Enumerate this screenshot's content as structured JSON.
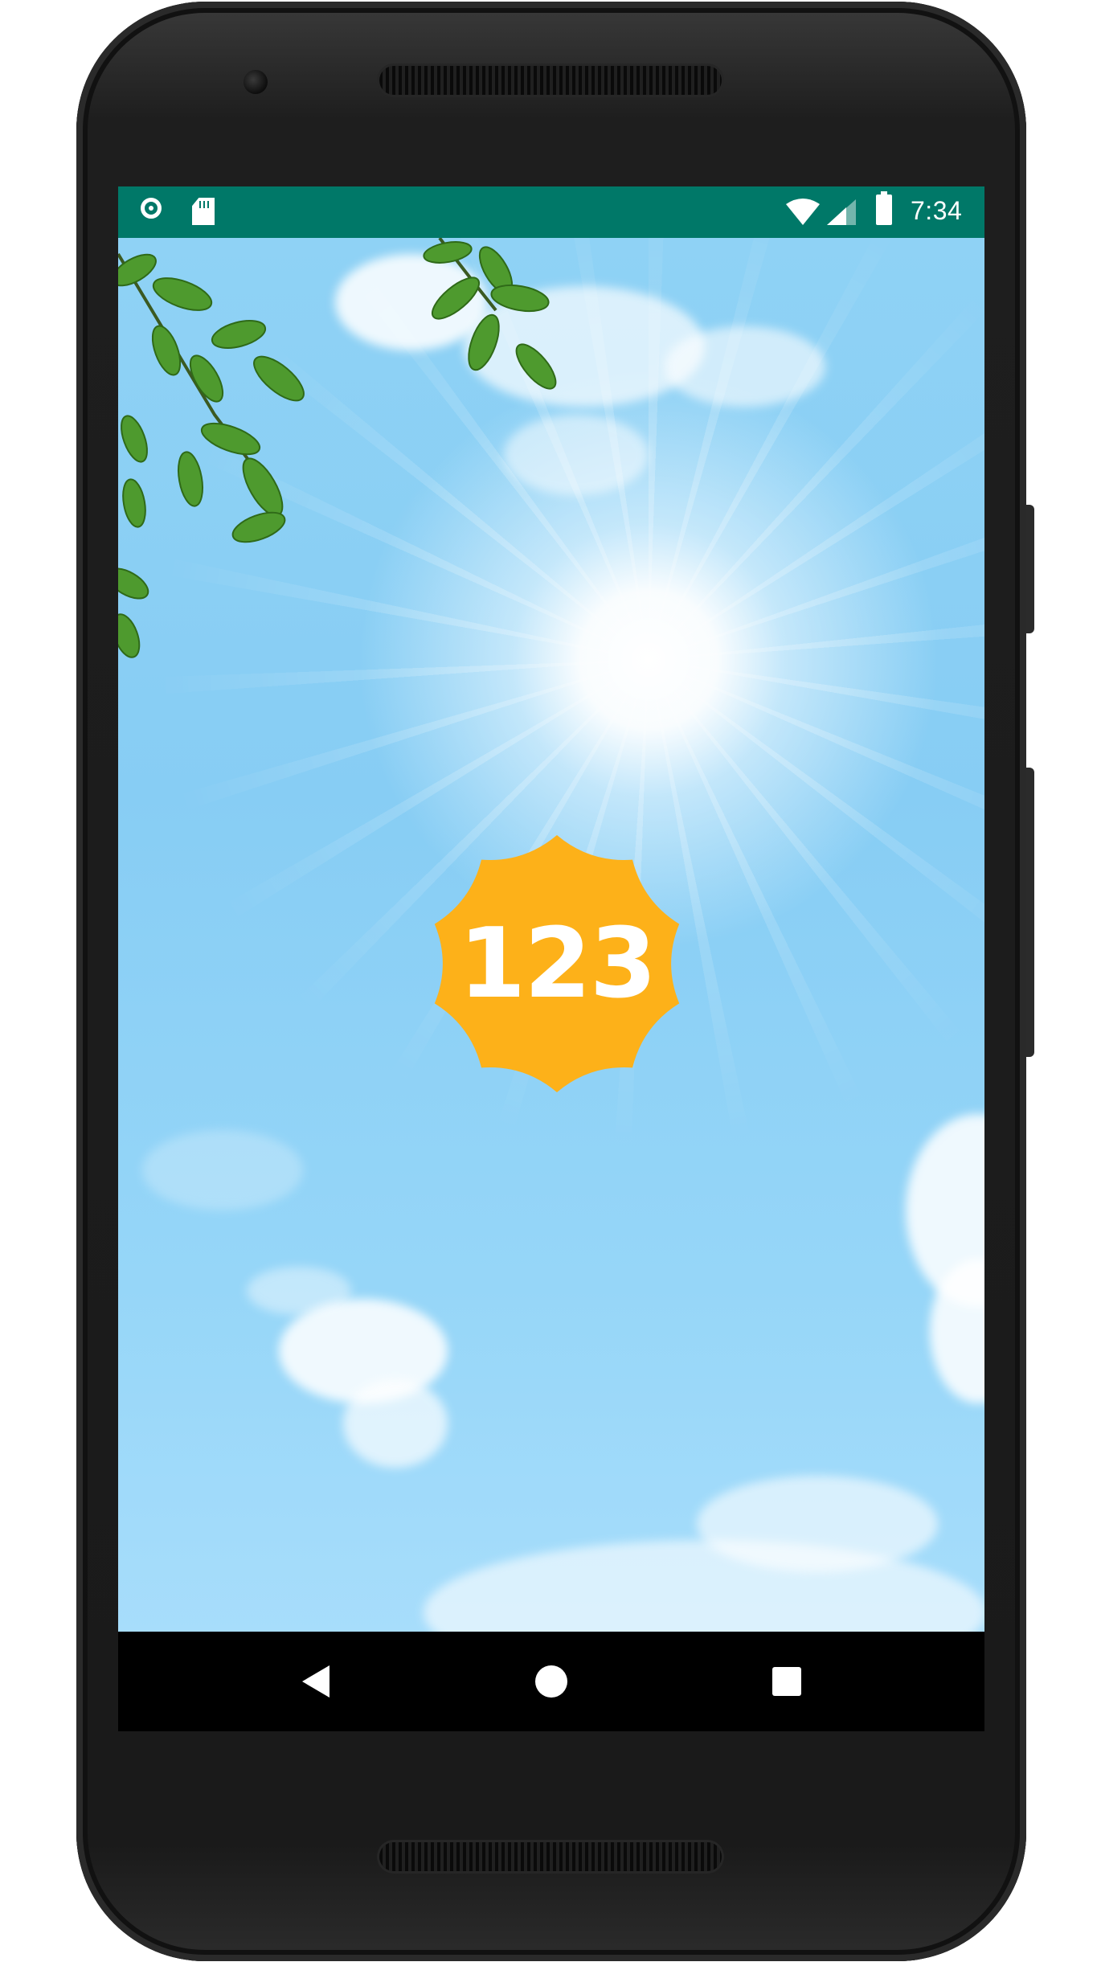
{
  "status_bar": {
    "time": "7:34",
    "icons": [
      "ring-icon",
      "sd-card-icon",
      "wifi-icon",
      "cell-signal-icon",
      "battery-icon"
    ],
    "background_color": "#007868"
  },
  "app": {
    "badge_text": "123",
    "badge_color": "#FDB119"
  },
  "nav_bar": {
    "icons": [
      "back-icon",
      "home-icon",
      "recents-icon"
    ]
  }
}
